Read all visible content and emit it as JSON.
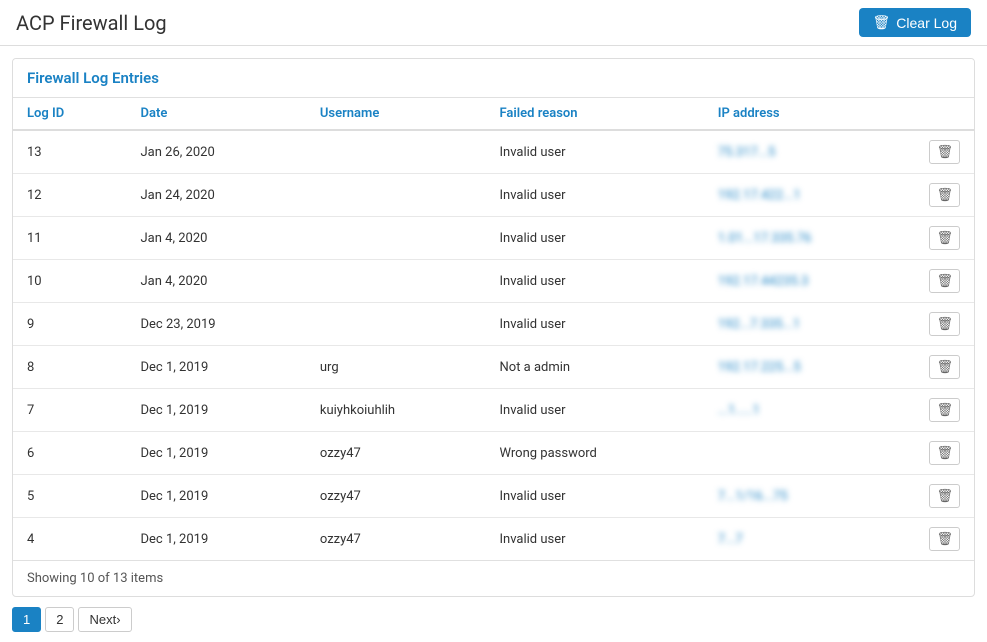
{
  "header": {
    "title": "ACP Firewall Log",
    "clear_log_label": "Clear Log"
  },
  "table": {
    "section_title": "Firewall Log Entries",
    "columns": [
      {
        "key": "log_id",
        "label": "Log ID"
      },
      {
        "key": "date",
        "label": "Date"
      },
      {
        "key": "username",
        "label": "Username"
      },
      {
        "key": "failed_reason",
        "label": "Failed reason"
      },
      {
        "key": "ip_address",
        "label": "IP address"
      }
    ],
    "rows": [
      {
        "log_id": "13",
        "date": "Jan 26, 2020",
        "username": "",
        "failed_reason": "Invalid user",
        "ip": "75.317...5",
        "ip_blurred": true
      },
      {
        "log_id": "12",
        "date": "Jan 24, 2020",
        "username": "",
        "failed_reason": "Invalid user",
        "ip": "192.17.422...1",
        "ip_blurred": true
      },
      {
        "log_id": "11",
        "date": "Jan 4, 2020",
        "username": "",
        "failed_reason": "Invalid user",
        "ip": "1.01...17.335.76",
        "ip_blurred": true
      },
      {
        "log_id": "10",
        "date": "Jan 4, 2020",
        "username": "",
        "failed_reason": "Invalid user",
        "ip": "192.17.44235.3",
        "ip_blurred": true
      },
      {
        "log_id": "9",
        "date": "Dec 23, 2019",
        "username": "",
        "failed_reason": "Invalid user",
        "ip": "192...7.335...1",
        "ip_blurred": true
      },
      {
        "log_id": "8",
        "date": "Dec 1, 2019",
        "username": "urg",
        "failed_reason": "Not a admin",
        "ip": "192.17.225...5",
        "ip_blurred": true
      },
      {
        "log_id": "7",
        "date": "Dec 1, 2019",
        "username": "kuiyhkoiuhlih",
        "failed_reason": "Invalid user",
        "ip": "...1.....1",
        "ip_blurred": true
      },
      {
        "log_id": "6",
        "date": "Dec 1, 2019",
        "username": "ozzy47",
        "failed_reason": "Wrong password",
        "ip": "",
        "ip_blurred": false
      },
      {
        "log_id": "5",
        "date": "Dec 1, 2019",
        "username": "ozzy47",
        "failed_reason": "Invalid user",
        "ip": "7...1/16...75",
        "ip_blurred": true
      },
      {
        "log_id": "4",
        "date": "Dec 1, 2019",
        "username": "ozzy47",
        "failed_reason": "Invalid user",
        "ip": "7...7",
        "ip_blurred": true
      }
    ],
    "footer": "Showing 10 of 13 items"
  },
  "pagination": {
    "pages": [
      "1",
      "2"
    ],
    "next_label": "Next›",
    "active_page": "1"
  }
}
